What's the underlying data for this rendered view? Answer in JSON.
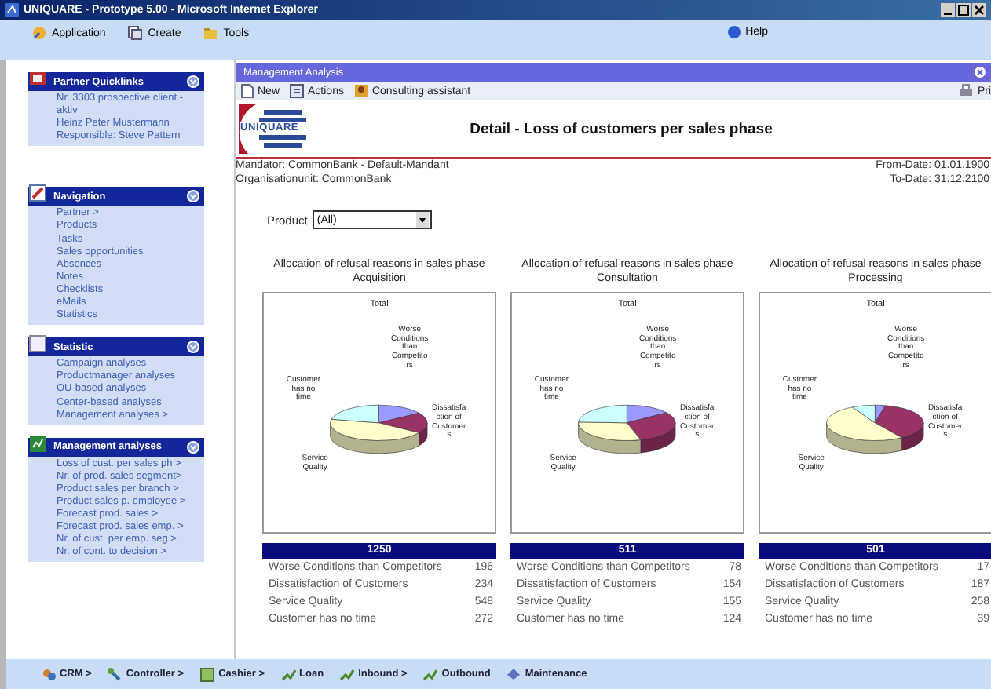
{
  "window": {
    "title": "UNIQUARE - Prototype 5.00 - Microsoft Internet Explorer"
  },
  "menu": [
    {
      "label": "Application"
    },
    {
      "label": "Create"
    },
    {
      "label": "Tools"
    }
  ],
  "help": "Help",
  "sidebar": {
    "panels": [
      {
        "title": "Partner Quicklinks",
        "items": [
          "Nr. 3303 prospective client - aktiv",
          "Heinz Peter Mustermann",
          "Responsible: Steve Pattern"
        ]
      },
      {
        "title": "Navigation",
        "items": [
          "Partner >",
          "Products",
          "Tasks",
          "Sales opportunities",
          "Absences",
          "Notes",
          "Checklists",
          "eMails",
          "Statistics"
        ]
      },
      {
        "title": "Statistic",
        "items": [
          "Campaign analyses",
          "Productmanager analyses",
          "OU-based analyses",
          "Center-based analyses",
          "Management analyses >"
        ]
      },
      {
        "title": "Management analyses",
        "items": [
          "Loss of cust. per sales ph >",
          "Nr. of prod. sales segment>",
          "Product sales per branch >",
          "Product sales p. employee >",
          "Forecast prod. sales >",
          "Forecast prod. sales emp. >",
          "Nr. of cust. per emp. seg >",
          "Nr. of cont. to decision >"
        ]
      }
    ]
  },
  "panel": {
    "title": "Management Analysis",
    "toolbar": [
      {
        "label": "New"
      },
      {
        "label": "Actions"
      },
      {
        "label": "Consulting assistant"
      }
    ],
    "print": "Pri",
    "logo": "UNIQUARE",
    "heading": "Detail - Loss of customers per sales phase",
    "mandator": "Mandator: CommonBank - Default-Mandant",
    "orgunit": "Organisationunit: CommonBank",
    "from_date": "From-Date: 01.01.1900",
    "to_date": "To-Date: 31.12.2100",
    "product_label": "Product",
    "product_value": "(All)"
  },
  "phases": [
    {
      "title": "Allocation of refusal reasons in sales phase",
      "phase": "Acquisition",
      "caption": "Total",
      "slice_labels": [
        "Worse Conditions than Competitors",
        "Customer has no time",
        "Dissatisfaction of Customers",
        "Service Quality"
      ],
      "total": "1250",
      "rows": [
        {
          "label": "Worse Conditions than Competitors",
          "value": "196",
          "color": "#9999ff"
        },
        {
          "label": "Dissatisfaction of Customers",
          "value": "234",
          "color": "#993366"
        },
        {
          "label": "Service Quality",
          "value": "548",
          "color": "#ffffcc"
        },
        {
          "label": "Customer has no time",
          "value": "272",
          "color": "#ccffff"
        }
      ]
    },
    {
      "title": "Allocation of refusal reasons in sales phase",
      "phase": "Consultation",
      "caption": "Total",
      "slice_labels": [
        "Worse Conditions than Competitors",
        "Customer has no time",
        "Dissatisfaction of Customers",
        "Service Quality"
      ],
      "total": "511",
      "rows": [
        {
          "label": "Worse Conditions than Competitors",
          "value": "78",
          "color": "#9999ff"
        },
        {
          "label": "Dissatisfaction of Customers",
          "value": "154",
          "color": "#993366"
        },
        {
          "label": "Service Quality",
          "value": "155",
          "color": "#ffffcc"
        },
        {
          "label": "Customer has no time",
          "value": "124",
          "color": "#ccffff"
        }
      ]
    },
    {
      "title": "Allocation of refusal reasons in sales phase",
      "phase": "Processing",
      "caption": "Total",
      "slice_labels": [
        "Worse Conditions than Competitors",
        "Customer has no time",
        "Dissatisfaction of Customers",
        "Service Quality"
      ],
      "total": "501",
      "rows": [
        {
          "label": "Worse Conditions than Competitors",
          "value": "17",
          "color": "#9999ff"
        },
        {
          "label": "Dissatisfaction of Customers",
          "value": "187",
          "color": "#993366"
        },
        {
          "label": "Service Quality",
          "value": "258",
          "color": "#ffffcc"
        },
        {
          "label": "Customer has no time",
          "value": "39",
          "color": "#ccffff"
        }
      ]
    }
  ],
  "taskbar": [
    {
      "label": "CRM >"
    },
    {
      "label": "Controller >"
    },
    {
      "label": "Cashier >"
    },
    {
      "label": "Loan"
    },
    {
      "label": "Inbound >"
    },
    {
      "label": "Outbound"
    },
    {
      "label": "Maintenance"
    }
  ]
}
